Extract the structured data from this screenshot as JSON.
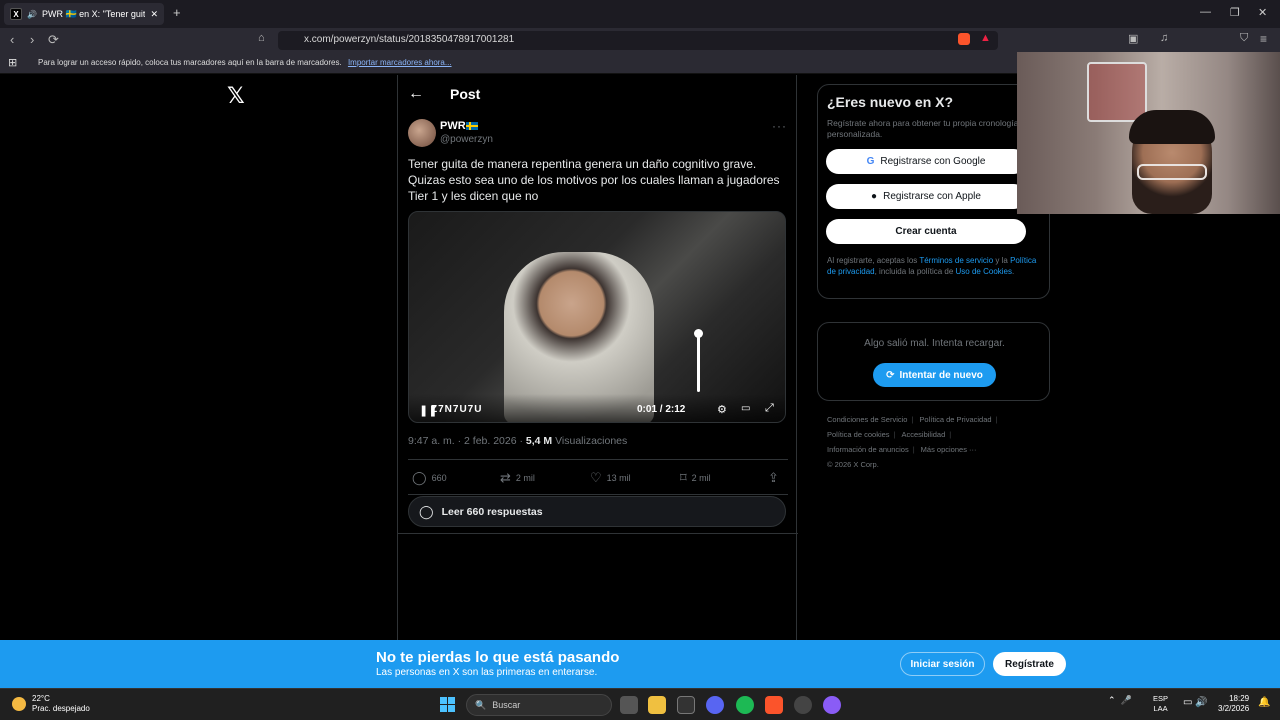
{
  "browser": {
    "tab_title": "PWR 🇸🇪 en X: \"Tener guita de",
    "tab_close": "✕",
    "new_tab": "+",
    "url": "x.com/powerzyn/status/2018350478917001281",
    "bookmarks_hint": "Para lograr un acceso rápido, coloca tus marcadores aquí en la barra de marcadores.",
    "bookmarks_import": "Importar marcadores ahora..."
  },
  "post": {
    "header_title": "Post",
    "author_name": "PWR",
    "author_handle": "@powerzyn",
    "text": "Tener guita de manera repentina genera un daño cognitivo grave. Quizas esto sea uno de los motivos por los cuales llaman a jugadores Tier 1 y les dicen que no",
    "video": {
      "overlay_text": "Z7N7U7U",
      "time": "0:01 / 2:12",
      "progress": 0.008
    },
    "meta_time": "9:47 a. m. · 2 feb. 2026 · ",
    "views_count": "5,4 M",
    "views_label": " Visualizaciones",
    "metrics": {
      "replies": "660",
      "reposts": "2 mil",
      "likes": "13 mil",
      "bookmarks": "2 mil"
    },
    "read_replies": "Leer 660 respuestas"
  },
  "sidebar": {
    "signup_title": "¿Eres nuevo en X?",
    "signup_desc": "Regístrate ahora para obtener tu propia cronología personalizada.",
    "google_btn": "Registrarse con Google",
    "apple_btn": "Registrarse con Apple",
    "create_btn": "Crear cuenta",
    "terms_a": "Al registrarte, aceptas los ",
    "terms_link1": "Términos de servicio",
    "terms_b": " y la ",
    "terms_link2": "Política de privacidad",
    "terms_c": ", incluida la política de ",
    "terms_link3": "Uso de Cookies",
    "terms_d": ".",
    "error_text": "Algo salió mal. Intenta recargar.",
    "retry_btn": "Intentar de nuevo",
    "footer": {
      "tos": "Condiciones de Servicio",
      "privacy": "Política de Privacidad",
      "cookies": "Política de cookies",
      "accessibility": "Accesibilidad",
      "ads": "Información de anuncios",
      "more": "Más opciones ···",
      "copyright": "© 2026 X Corp."
    }
  },
  "banner": {
    "title": "No te pierdas lo que está pasando",
    "subtitle": "Las personas en X son las primeras en enterarse.",
    "login": "Iniciar sesión",
    "signup": "Regístrate"
  },
  "taskbar": {
    "temp": "22°C",
    "weather": "Prac. despejado",
    "search": "Buscar",
    "lang1": "ESP",
    "lang2": "LAA",
    "time": "18:29",
    "date": "3/2/2026"
  },
  "colors": {
    "accent": "#1d9bf0",
    "background": "#000000",
    "border": "#2f3336"
  }
}
